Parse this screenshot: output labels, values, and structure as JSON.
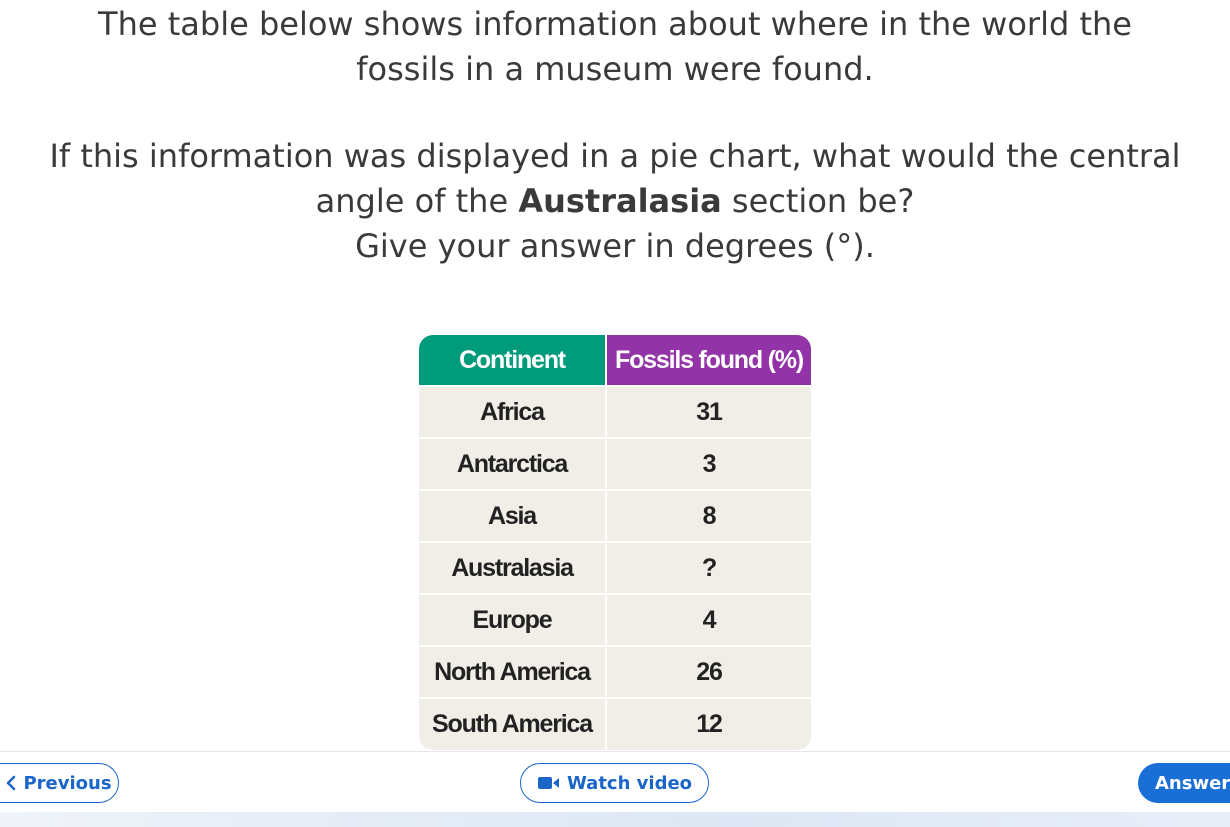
{
  "question": {
    "line1": "The table below shows information about where in the world the",
    "line2": "fossils in a museum were found.",
    "line3": "If this information was displayed in a pie chart, what would the central",
    "line4_before": "angle of the ",
    "line4_bold": "Australasia",
    "line4_after": " section be?",
    "line5": "Give your answer in degrees (°)."
  },
  "table": {
    "headers": [
      "Continent",
      "Fossils found (%)"
    ],
    "header_colors": [
      "#009b7a",
      "#9333a8"
    ],
    "rows": [
      [
        "Africa",
        "31"
      ],
      [
        "Antarctica",
        "3"
      ],
      [
        "Asia",
        "8"
      ],
      [
        "Australasia",
        "?"
      ],
      [
        "Europe",
        "4"
      ],
      [
        "North America",
        "26"
      ],
      [
        "South America",
        "12"
      ]
    ]
  },
  "footer": {
    "previous_label": "Previous",
    "previous_icon": "chevron-left-icon",
    "video_label": "Watch video",
    "video_icon": "video-camera-icon",
    "answer_label": "Answer",
    "accent_color": "#1b65c9"
  }
}
